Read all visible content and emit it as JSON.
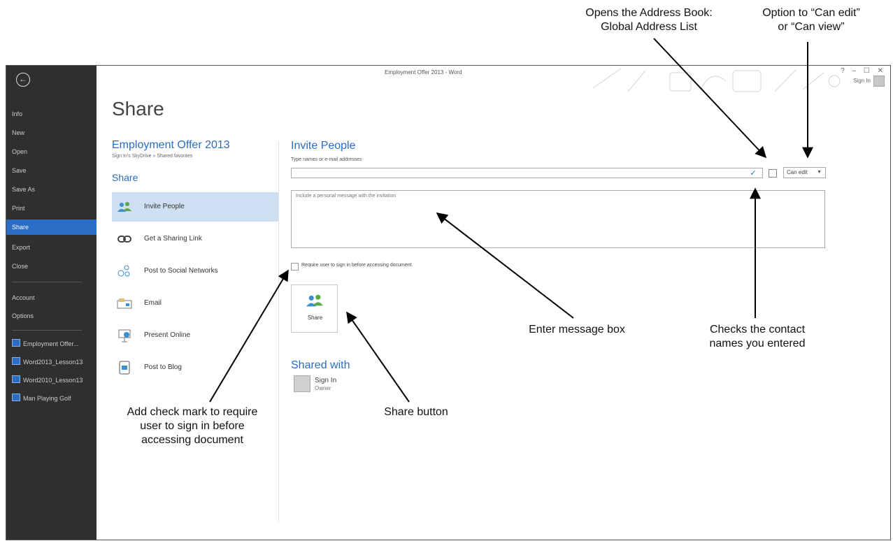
{
  "window_title": "Employment Offer 2013 - Word",
  "window_controls": "? – ☐ ✕",
  "account": {
    "signin_label": "Sign In"
  },
  "backstage_nav": {
    "back_glyph": "←",
    "items": [
      {
        "label": "Info",
        "active": false
      },
      {
        "label": "New",
        "active": false
      },
      {
        "label": "Open",
        "active": false
      },
      {
        "label": "Save",
        "active": false
      },
      {
        "label": "Save As",
        "active": false
      },
      {
        "label": "Print",
        "active": false
      },
      {
        "label": "Share",
        "active": true
      },
      {
        "label": "Export",
        "active": false
      },
      {
        "label": "Close",
        "active": false
      }
    ],
    "account_items": [
      {
        "label": "Account"
      },
      {
        "label": "Options"
      }
    ],
    "recent": [
      {
        "label": "Employment Offer..."
      },
      {
        "label": "Word2013_Lesson13"
      },
      {
        "label": "Word2010_Lesson13"
      },
      {
        "label": "Man Playing Golf"
      }
    ]
  },
  "page_heading": "Share",
  "document": {
    "title": "Employment Offer 2013",
    "path": "Sign In's SkyDrive » Shared favorites"
  },
  "share_section_label": "Share",
  "share_options": [
    {
      "label": "Invite People",
      "icon": "invite-people-icon",
      "selected": true
    },
    {
      "label": "Get a Sharing Link",
      "icon": "link-icon",
      "selected": false
    },
    {
      "label": "Post to Social Networks",
      "icon": "social-networks-icon",
      "selected": false
    },
    {
      "label": "Email",
      "icon": "email-icon",
      "selected": false
    },
    {
      "label": "Present Online",
      "icon": "present-online-icon",
      "selected": false
    },
    {
      "label": "Post to Blog",
      "icon": "blog-icon",
      "selected": false
    }
  ],
  "invite": {
    "heading": "Invite People",
    "names_label": "Type names or e-mail addresses",
    "names_value": "",
    "permission_selected": "Can edit",
    "message_placeholder": "Include a personal message with the invitation",
    "require_signin_label": "Require user to sign in before accessing document.",
    "require_signin_checked": false,
    "share_button_label": "Share"
  },
  "shared_with": {
    "heading": "Shared with",
    "owner_name": "Sign In",
    "owner_role": "Owner"
  },
  "callouts": {
    "address_book": [
      "Opens the Address Book:",
      "Global Address List"
    ],
    "permission": [
      "Option to “Can edit”",
      "or “Can view”"
    ],
    "message_box": "Enter message box",
    "check_names": [
      "Checks the contact",
      "names you entered"
    ],
    "require_signin": [
      "Add check mark to require",
      "user to sign in before",
      "accessing document"
    ],
    "share_button": "Share button"
  },
  "colors": {
    "accent": "#2b6cc4",
    "sidebar": "#2f2f2f",
    "selected_option": "#cfdff2"
  }
}
